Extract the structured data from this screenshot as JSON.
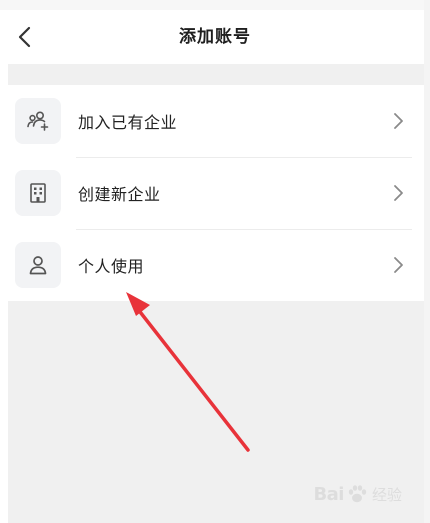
{
  "header": {
    "title": "添加账号"
  },
  "menu": {
    "items": [
      {
        "label": "加入已有企业",
        "icon": "join-team-icon"
      },
      {
        "label": "创建新企业",
        "icon": "building-icon"
      },
      {
        "label": "个人使用",
        "icon": "person-icon"
      }
    ]
  },
  "watermark": {
    "brand": "Bai",
    "brand_suffix": "经验"
  },
  "colors": {
    "arrow": "#e8333a",
    "icon_bg": "#f2f3f5",
    "page_bg": "#f0f0f0"
  }
}
